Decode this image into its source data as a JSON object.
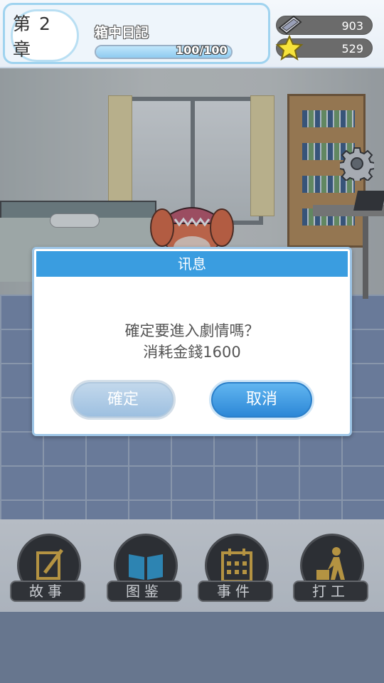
{
  "header": {
    "chapter": "第 2 章",
    "title": "箱中日記",
    "progress_text": "100/100",
    "progress_fraction": 1.0
  },
  "resources": {
    "tickets": {
      "icon": "ticket-icon",
      "value": "903"
    },
    "stars": {
      "icon": "star-icon",
      "value": "529"
    }
  },
  "settings": {
    "icon": "gear-icon"
  },
  "menu": {
    "items": [
      {
        "label": "故事",
        "icon": "scroll-quill-icon"
      },
      {
        "label": "图鉴",
        "icon": "book-icon"
      },
      {
        "label": "事件",
        "icon": "calendar-icon"
      },
      {
        "label": "打工",
        "icon": "worker-icon"
      }
    ]
  },
  "dialog": {
    "title": "讯息",
    "message_line1": "確定要進入劇情嗎？",
    "message_line2": "消耗金錢1600",
    "ok_label": "確定",
    "cancel_label": "取消"
  },
  "colors": {
    "dialog_header": "#3a9de0",
    "cancel_button": "#2a86d6",
    "menu_icon_gold": "#e3b341"
  }
}
